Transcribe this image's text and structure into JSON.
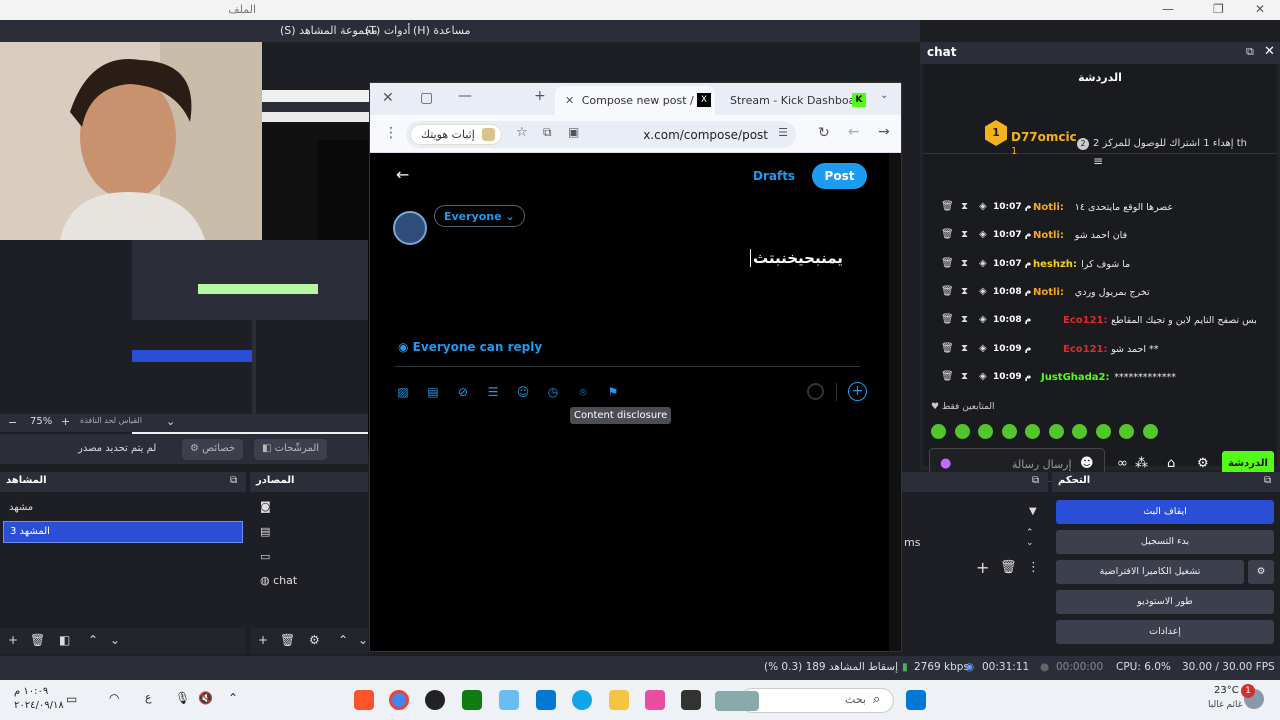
{
  "obs": {
    "title": "الملف",
    "menu": [
      "(S) مجموعة المشاهد",
      "(T) أدوات",
      "(H) مساعدة"
    ],
    "zoom": "75%",
    "fit_label": "القياس لحد النافذة",
    "no_source": "لم يتم تحديد مصدر",
    "properties_label": "خصائص",
    "filters_label": "المرشّحات",
    "scenes_title": "المشاهد",
    "scenes": [
      "مشهد",
      "المشهد 3"
    ],
    "sources_title": "المصادر",
    "sources": [
      "",
      "",
      "",
      "chat"
    ],
    "controls_title": "التحكم",
    "controls": [
      "ايقاف البث",
      "بدء التسجيل",
      "تشغيل الكاميرا الافتراضية",
      "طور الاستوديو",
      "إعدادات"
    ],
    "mixer_partial": "ms",
    "status": {
      "dropped": "إسقاط المشاهد 189 (0.3 %)",
      "kbps": "2769 kbps",
      "stream_time": "00:31:11",
      "rec_time": "00:00:00",
      "cpu": "CPU: 6.0%",
      "fps": "30.00 / 30.00 FPS"
    }
  },
  "browser": {
    "tabs": [
      "Compose new post / X",
      "Stream - Kick Dashboard"
    ],
    "url": "x.com/compose/post",
    "verify_label": "إثبات هويتك",
    "compose": {
      "drafts": "Drafts",
      "post": "Post",
      "audience": "Everyone",
      "text": "يمنبحيخنبتث",
      "reply_setting": "Everyone can reply",
      "tooltip": "Content disclosure"
    }
  },
  "chat": {
    "dock_title": "chat",
    "header": "الدردشة",
    "pinned": {
      "user": "D77omcic",
      "rank": "1",
      "count": "1",
      "message": "إهداء 1 اشتراك للوصول للمركز 2 th",
      "gift_badge": "2"
    },
    "messages": [
      {
        "time": "10:07 م",
        "user": "Notli:",
        "user_color": "#f5a623",
        "text": "عصرها الوقع مايتحدى ١٤"
      },
      {
        "time": "10:07 م",
        "user": "Notli:",
        "user_color": "#f5a623",
        "text": "فان احمد شو"
      },
      {
        "time": "10:07 م",
        "user": "heshzh:",
        "user_color": "#f5d31b",
        "text": "ما شوف كرا"
      },
      {
        "time": "10:08 م",
        "user": "Notli:",
        "user_color": "#f5a623",
        "text": "تخرج بمريول وردي"
      },
      {
        "time": "10:08 م",
        "user": "Eco121:",
        "user_color": "#e02b2b",
        "text": "بس تصفح التايم لاين و تجيك المقاطع"
      },
      {
        "time": "10:09 م",
        "user": "Eco121:",
        "user_color": "#e02b2b",
        "text": "احمد شو **"
      },
      {
        "time": "10:09 م",
        "user": "JustGhada2:",
        "user_color": "#53fc18",
        "text": "*************"
      }
    ],
    "subs_only": "المتابعين فقط",
    "input_placeholder": "إرسال رسالة",
    "send_label": "الدردشة"
  },
  "taskbar": {
    "search_placeholder": "بحث",
    "weather_temp": "23°C",
    "weather_desc": "غائم غالبا",
    "time": "١٠:٠٩ م",
    "date": "٢٠٢٤/٠٩/١٨",
    "notif_count": "1"
  },
  "colors": {
    "accent": "#1d9bf0",
    "kick_green": "#53fc18",
    "obs_blue": "#2a4fd6"
  }
}
